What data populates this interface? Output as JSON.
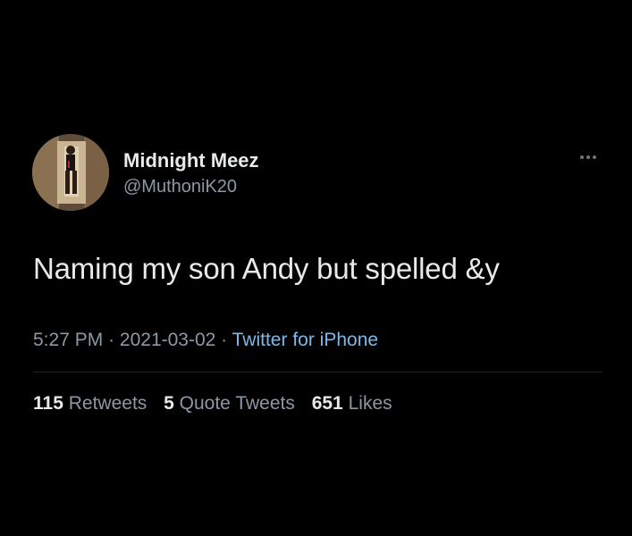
{
  "user": {
    "display_name": "Midnight Meez",
    "handle": "@MuthoniK20",
    "avatar_icon": "profile-photo"
  },
  "menu": {
    "icon": "more-horizontal-icon"
  },
  "tweet": {
    "text": "Naming my son Andy but spelled &y",
    "time": "5:27 PM",
    "date": "2021-03-02",
    "separator": "·",
    "source": "Twitter for iPhone"
  },
  "stats": {
    "retweets_count": "115",
    "retweets_label": "Retweets",
    "quotes_count": "5",
    "quotes_label": "Quote Tweets",
    "likes_count": "651",
    "likes_label": "Likes"
  },
  "colors": {
    "background": "#000000",
    "primary_text": "#e7e9ea",
    "secondary_text": "#8b98a5",
    "link": "#7fb8e6"
  }
}
